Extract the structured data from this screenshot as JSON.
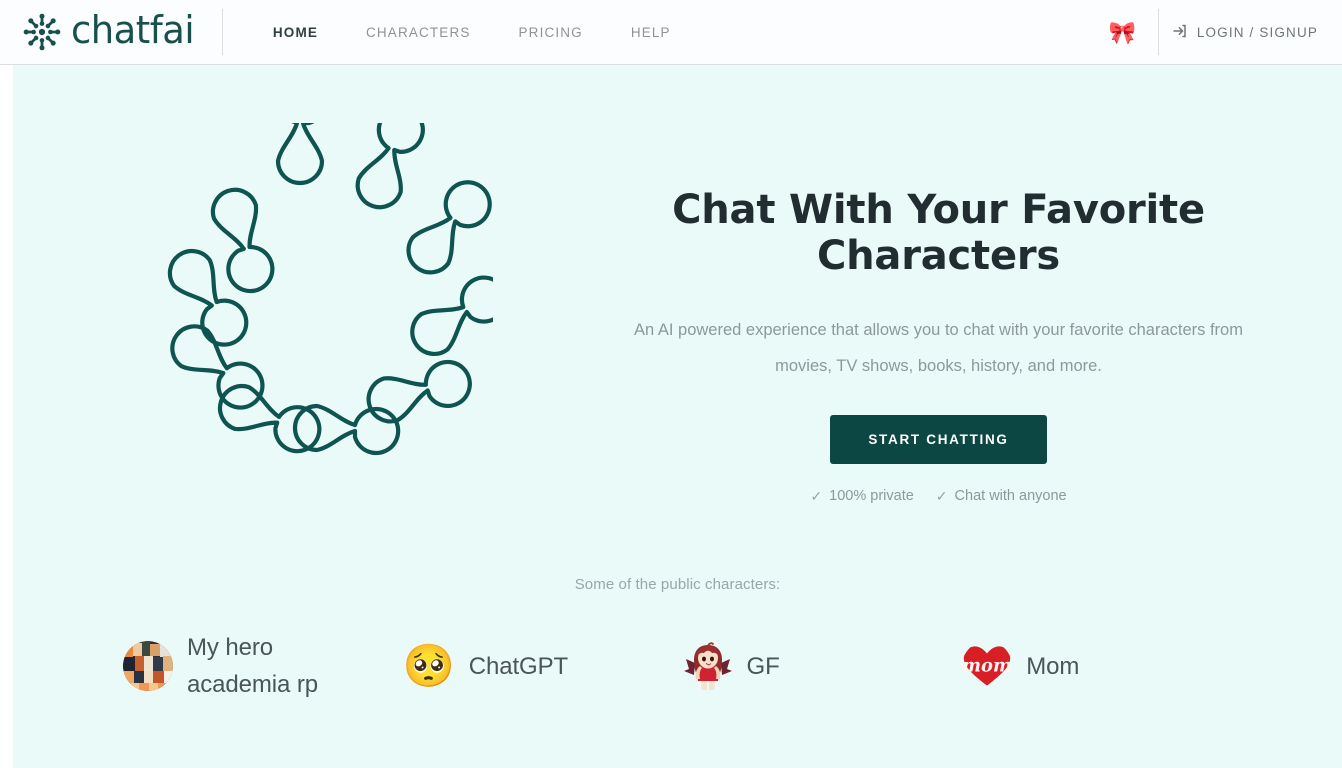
{
  "header": {
    "brand_name": "chatfai",
    "brand_icon": "chatfai-molecule-logo",
    "nav": [
      {
        "label": "HOME",
        "name": "nav-home",
        "active": true
      },
      {
        "label": "CHARACTERS",
        "name": "nav-characters",
        "active": false
      },
      {
        "label": "PRICING",
        "name": "nav-pricing",
        "active": false
      },
      {
        "label": "HELP",
        "name": "nav-help",
        "active": false
      }
    ],
    "ribbon_emoji": "🎀",
    "auth_label": "LOGIN / SIGNUP",
    "auth_icon": "sign-in-icon"
  },
  "hero": {
    "art_icon": "molecule-ring-illustration",
    "title": "Chat With Your Favorite Characters",
    "subtitle": "An AI powered experience that allows you to chat with your favorite characters from movies, TV shows, books, history, and more.",
    "cta_label": "START CHATTING",
    "trust": [
      {
        "label": "100% private",
        "icon": "check-icon"
      },
      {
        "label": "Chat with anyone",
        "icon": "check-icon"
      }
    ]
  },
  "characters": {
    "label": "Some of the public characters:",
    "items": [
      {
        "name": "My hero academia rp",
        "avatar_type": "image",
        "avatar_icon": "anime-crowd-avatar"
      },
      {
        "name": "ChatGPT",
        "avatar_type": "emoji",
        "avatar_icon": "pleading-face-emoji",
        "emoji": "🥺"
      },
      {
        "name": "GF",
        "avatar_type": "image",
        "avatar_icon": "anime-girl-red-dress-avatar"
      },
      {
        "name": "Mom",
        "avatar_type": "image",
        "avatar_icon": "red-heart-mom-avatar"
      }
    ]
  },
  "colors": {
    "brand_teal": "#17504c",
    "cta_teal": "#0d4744",
    "hero_background": "#eafaf8",
    "header_background": "#fcfdfe",
    "muted_text": "#8d989c",
    "heading_text": "#222d32",
    "ribbon_pink": "#ef4a8b"
  }
}
